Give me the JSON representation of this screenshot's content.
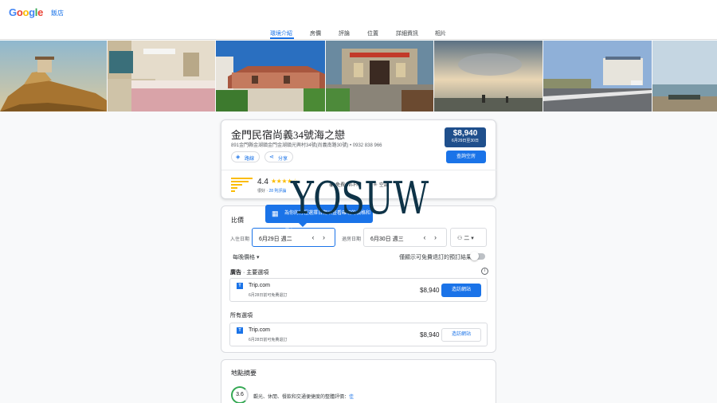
{
  "header": {
    "logo": "Google",
    "nav_hotels": "飯店"
  },
  "tabs": [
    "環境介紹",
    "房價",
    "評論",
    "位置",
    "詳細資訊",
    "相片"
  ],
  "active_tab": "環境介紹",
  "hotel": {
    "name": "金門民宿尚義34號海之戀",
    "address": "891金門縣金湖鎮金門金湖鎮光興村34號(尚義南路30號) • 0932 838 966",
    "directions_label": "路線",
    "share_label": "分享",
    "price": "$8,940",
    "price_dates": "6月29日至30日",
    "check_button": "查詢空房",
    "rating": "4.4",
    "rating_stars": "★★★★☆",
    "rating_label": "很好",
    "review_count": "28 則評論",
    "amenities": [
      {
        "icon": "wifi-icon",
        "label": "免費 Wi-Fi"
      },
      {
        "icon": "ac-icon",
        "label": "空調"
      }
    ]
  },
  "compare": {
    "title": "比價",
    "tooltip": "為你的行程選擇日期以查看確切的價格和優惠",
    "checkin_label": "入住日期",
    "checkin_value": "6月29日 週二",
    "checkout_label": "退房日期",
    "checkout_value": "6月30日 週三",
    "guests_value": "二",
    "nightly_label": "每晚價格",
    "free_cancel_label": "僅顯示可免費退訂的預訂結果",
    "ads_label": "廣告",
    "ads_sub": "主要選項",
    "all_label": "所有選項",
    "offers": [
      {
        "provider": "Trip.com",
        "note": "6月28日前可免費退訂",
        "price": "$8,940",
        "button": "造訪網站",
        "style": "primary"
      },
      {
        "provider": "Trip.com",
        "note": "6月28日前可免費退訂",
        "price": "$8,940",
        "button": "造訪網站",
        "style": "secondary"
      }
    ]
  },
  "location": {
    "title": "地點摘要",
    "score": "3.6",
    "desc": "觀光、休閒、餐飲和交通便捷度的整體評價：",
    "desc_link": "佳"
  },
  "watermark": "YOSUW",
  "colors": {
    "accent": "#1a73e8",
    "price_box": "#1f4f8c",
    "star": "#fbbc05"
  }
}
